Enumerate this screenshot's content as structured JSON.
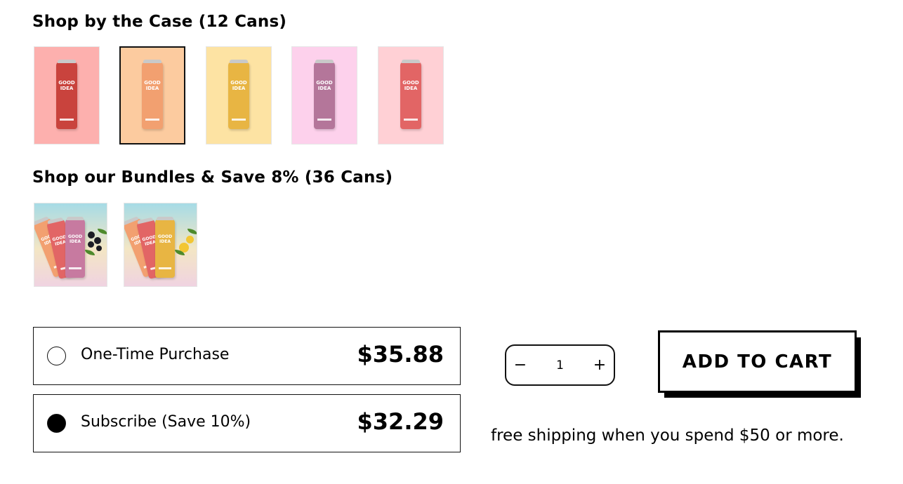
{
  "case_section": {
    "title": "Shop by the Case (12 Cans)",
    "products": [
      {
        "name": "flavor-1",
        "bg_color": "#fdb0ae",
        "can_color": "#c9433d",
        "selected": false
      },
      {
        "name": "flavor-2",
        "bg_color": "#fccb9f",
        "can_color": "#f2a070",
        "selected": true
      },
      {
        "name": "flavor-3",
        "bg_color": "#fde3a3",
        "can_color": "#e8b543",
        "selected": false
      },
      {
        "name": "flavor-4",
        "bg_color": "#fdd1ec",
        "can_color": "#b4769a",
        "selected": false
      },
      {
        "name": "flavor-5",
        "bg_color": "#ffd0d5",
        "can_color": "#e26565",
        "selected": false
      }
    ],
    "can_brand": [
      "GOOD",
      "IDEA"
    ]
  },
  "bundles_section": {
    "title": "Shop our Bundles & Save 8% (36 Cans)",
    "bundles": [
      {
        "name": "bundle-blackcurrant",
        "front_can": "#c77aa0",
        "fruit": "blackcurrant"
      },
      {
        "name": "bundle-lemon",
        "front_can": "#e8b543",
        "fruit": "lemon"
      }
    ]
  },
  "purchase_options": [
    {
      "id": "one-time",
      "label": "One-Time Purchase",
      "price": "$35.88",
      "selected": false
    },
    {
      "id": "subscribe",
      "label": "Subscribe (Save 10%)",
      "price": "$32.29",
      "selected": true
    }
  ],
  "quantity": {
    "value": "1",
    "minus_icon": "−",
    "plus_icon": "+"
  },
  "cart": {
    "button_label": "ADD TO CART"
  },
  "shipping_note": "free shipping when you spend $50 or more."
}
